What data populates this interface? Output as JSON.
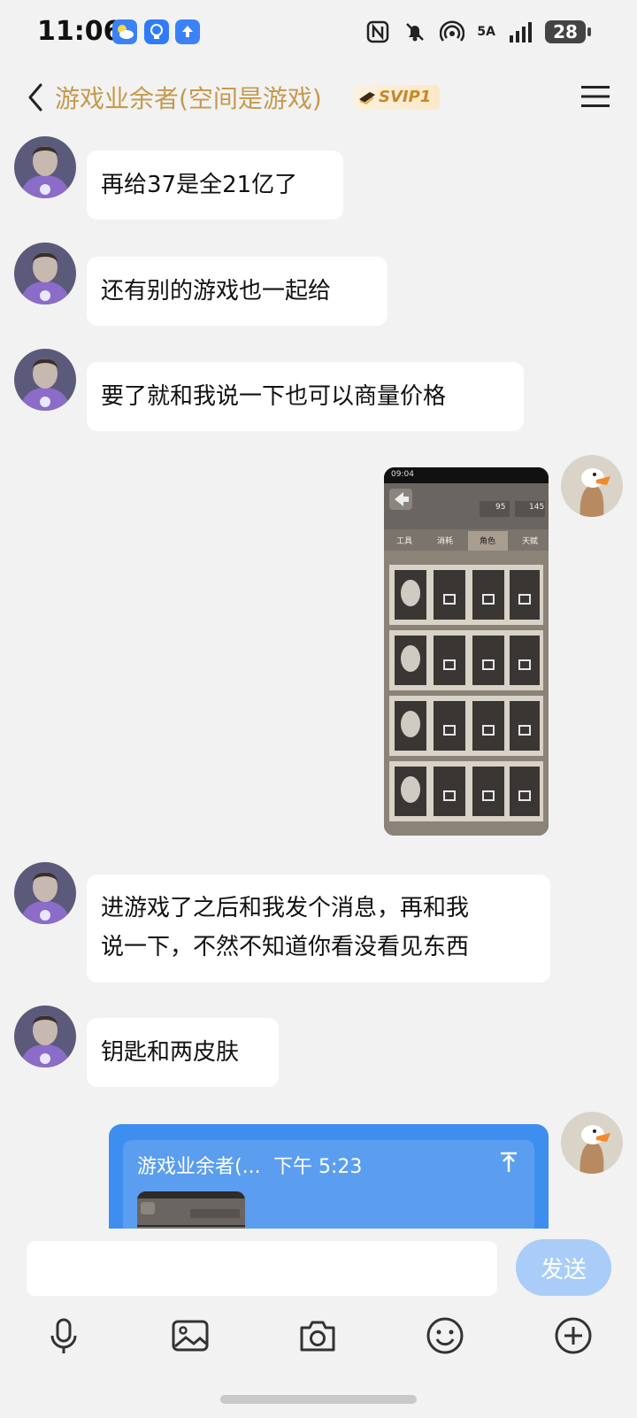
{
  "status": {
    "time": "11:06",
    "network": "5A",
    "battery": "28"
  },
  "header": {
    "title": "游戏业余者(空间是游戏)",
    "badge": "SVIP1"
  },
  "messages": [
    {
      "text": "再给37是全21亿了"
    },
    {
      "text": "还有别的游戏也一起给"
    },
    {
      "text": "要了就和我说一下也可以商量价格"
    },
    {
      "line1": "进游戏了之后和我发个消息，再和我",
      "line2": "说一下，不然不知道你看没看见东西"
    },
    {
      "text": "钥匙和两皮肤"
    }
  ],
  "screenshot": {
    "status_time": "09:04",
    "coins_a": "95",
    "coins_b": "145",
    "tabs": [
      "工具",
      "消耗",
      "角色",
      "天赋"
    ]
  },
  "share": {
    "name": "游戏业余者(...",
    "time": "下午 5:23"
  },
  "composer": {
    "placeholder": "",
    "send_label": "发送"
  },
  "icons": {
    "mic": "mic-icon",
    "image": "image-icon",
    "camera": "camera-icon",
    "emoji": "emoji-icon",
    "plus": "plus-icon"
  }
}
